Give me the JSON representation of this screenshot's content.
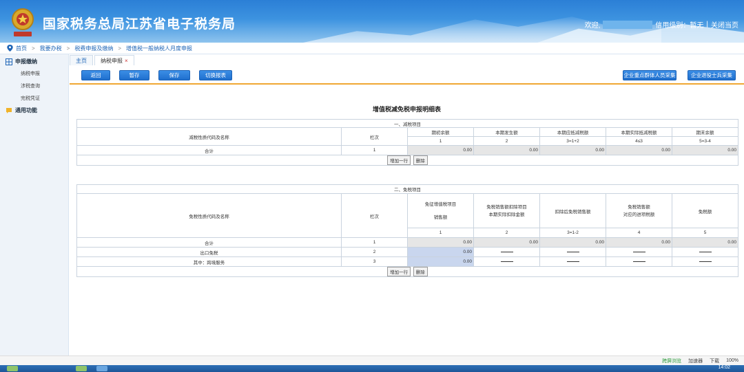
{
  "header": {
    "title": "国家税务总局江苏省电子税务局",
    "welcome": "欢迎,",
    "credit_label": "信用级别：暂无",
    "divider": "|",
    "close_tab": "关闭当页"
  },
  "breadcrumb": {
    "items": [
      "首页",
      "我要办税",
      "税费申报及缴纳",
      "增值税一般纳税人月度申报"
    ],
    "separator": ">"
  },
  "sidebar": {
    "group1": "申报缴纳",
    "items": [
      "纳税申报",
      "涉税查询",
      "完税凭证"
    ],
    "group2": "通用功能"
  },
  "tabs": [
    {
      "label": "主页"
    },
    {
      "label": "纳税申报",
      "close": "×"
    }
  ],
  "toolbar": {
    "back": "返回",
    "temp_save": "暂存",
    "save": "保存",
    "switch": "切换报表",
    "right1": "企业重点群体人员采集",
    "right2": "企业退役士兵采集"
  },
  "form": {
    "title": "增值税减免税申报明细表",
    "section1": {
      "heading": "一、减税项目",
      "col_name": "减税性质代码及名称",
      "col_line": "栏次",
      "cols": [
        "期初余额",
        "本期发生额",
        "本期应抵减税额",
        "本期实际抵减税额",
        "期末余额"
      ],
      "col_codes": [
        "1",
        "2",
        "3=1+2",
        "4≤3",
        "5=3-4"
      ],
      "rows": [
        {
          "name": "合计",
          "line": "1",
          "values": [
            "0.00",
            "0.00",
            "0.00",
            "0.00",
            "0.00"
          ]
        }
      ]
    },
    "section2": {
      "heading": "二、免税项目",
      "col_name": "免税性质代码及名称",
      "col_line": "栏次",
      "col1_line1": "免征增值税项目",
      "col1_line2": "销售额",
      "col2_line1": "免税销售额扣除项目",
      "col2_line2": "本期实际扣除金额",
      "col3": "扣除后免税销售额",
      "col4_line1": "免税销售额",
      "col4_line2": "对应的进项税额",
      "col5": "免税额",
      "col_codes": [
        "1",
        "2",
        "3=1-2",
        "4",
        "5"
      ],
      "rows": [
        {
          "name": "合计",
          "line": "1",
          "values": [
            "0.00",
            "0.00",
            "0.00",
            "0.00",
            "0.00"
          ]
        },
        {
          "name": "出口免税",
          "line": "2",
          "values": [
            "0.00"
          ]
        },
        {
          "name": "其中：跨境服务",
          "line": "3",
          "values": [
            "0.00"
          ]
        }
      ]
    },
    "add_row": "增加一行",
    "delete": "删除"
  },
  "statusbar": {
    "mode": "跨屏浏览",
    "accelerator": "加速器",
    "download": "下载",
    "zoom": "100%"
  },
  "taskbar": {
    "time": "14:02"
  }
}
